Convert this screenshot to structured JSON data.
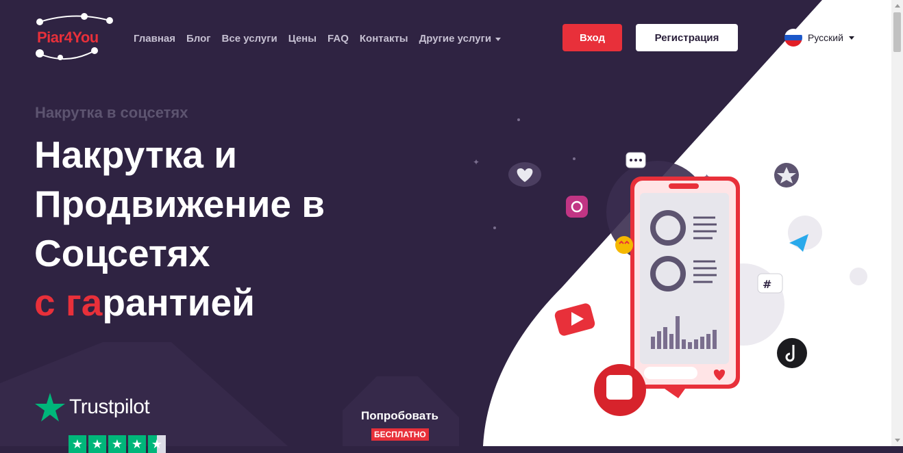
{
  "header": {
    "logo_text": "Piar4You",
    "nav": [
      {
        "label": "Главная"
      },
      {
        "label": "Блог"
      },
      {
        "label": "Все услуги"
      },
      {
        "label": "Цены"
      },
      {
        "label": "FAQ"
      },
      {
        "label": "Контакты"
      },
      {
        "label": "Другие услуги"
      }
    ],
    "login_label": "Вход",
    "register_label": "Регистрация",
    "language": "Русский"
  },
  "hero": {
    "eyebrow": "Накрутка в соцсетях",
    "title_line1": "Накрутка и",
    "title_line2": "Продвижение в",
    "title_line3": "Соцсетях",
    "title_accent": "с га",
    "title_rest": "рантией"
  },
  "trustpilot": {
    "label": "Trustpilot",
    "stars": 5
  },
  "try_free": {
    "title": "Попробовать",
    "badge": "БЕСПЛАТНО"
  },
  "colors": {
    "accent": "#e8303a",
    "background": "#2f2342",
    "trustpilot_green": "#00b67a"
  },
  "icons": [
    "instagram-icon",
    "telegram-icon",
    "tiktok-icon",
    "youtube-icon",
    "like-icon",
    "heart-icon",
    "hashtag-icon",
    "chat-icon",
    "emoji-icon",
    "star-icon"
  ]
}
